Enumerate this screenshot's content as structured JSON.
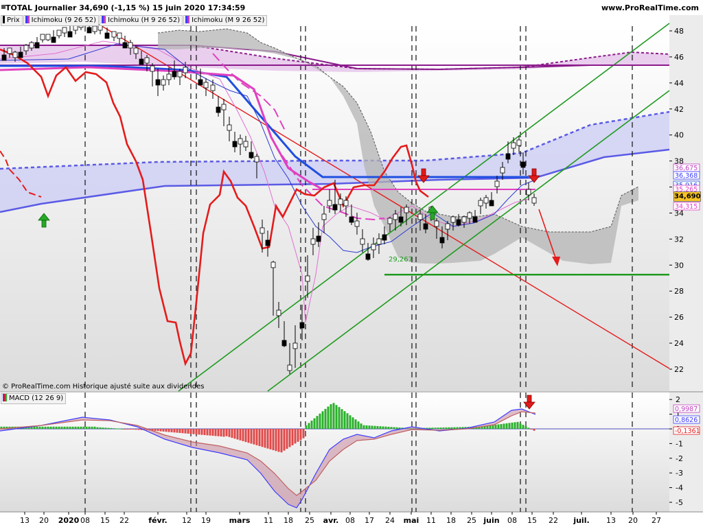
{
  "header": {
    "title": "TOTAL Journalier 34,690 (-1,15 %) 15 juin 2020 17:34:59",
    "site": "www.ProRealTime.com"
  },
  "legend": {
    "items": [
      {
        "label": "Prix",
        "color": "#000000"
      },
      {
        "label": "Ichimoku (9 26 52)",
        "color": "#3c3cff"
      },
      {
        "label": "Ichimoku (H 9 26 52)",
        "color": "#c040c0"
      },
      {
        "label": "Ichimoku (M 9 26 52)",
        "color": "#9090ff"
      }
    ]
  },
  "watermark": "© ProRealTime.com Historique ajusté suite aux dividendes",
  "macd_legend": "MACD (12 26 9)",
  "price_tag": "34,690",
  "annotations": {
    "support_label": "29,267"
  },
  "colors": {
    "price_axis_bg": "#ececec",
    "cloud_grey": "#b4b4b4",
    "cloud_purple": "#e3bfe8",
    "cloud_blue": "#c9c9f5",
    "kijun_blue": "#1f4fe0",
    "red_line": "#e51b1b",
    "green_line": "#1e9a1e",
    "arrow_red": "#e01b1b",
    "arrow_green": "#28a828"
  },
  "chart_data": [
    {
      "type": "candlestick",
      "title": "TOTAL Journalier",
      "y_axis_ticks": [
        48,
        46,
        44,
        42,
        40,
        38,
        36,
        34,
        32,
        30,
        28,
        26,
        24,
        22
      ],
      "y_range": [
        20,
        49
      ],
      "x_tick_labels": [
        "13",
        "20",
        "2020",
        "08",
        "15",
        "22",
        "févr.",
        "12",
        "19",
        "mars",
        "11",
        "18",
        "25",
        "avr.",
        "08",
        "17",
        "24",
        "mai",
        "11",
        "18",
        "25",
        "juin",
        "08",
        "15",
        "22",
        "juil.",
        "13",
        "20",
        "27"
      ],
      "price_labels": [
        {
          "label": "36,675",
          "value": 36.675,
          "color": "#c040c0"
        },
        {
          "label": "36,368",
          "value": 36.368,
          "color": "#3c3cff"
        },
        {
          "label": "35,916",
          "value": 35.916,
          "color": "#1f4fe0"
        },
        {
          "label": "35,265",
          "value": 35.265,
          "color": "#e040c0"
        },
        {
          "label": "34,690",
          "value": 34.69,
          "color": "#000000"
        },
        {
          "label": "34,315",
          "value": 34.315,
          "color": "#e040c0"
        }
      ],
      "last_close": 34.69,
      "support_level": 29.267
    },
    {
      "type": "bar",
      "title": "MACD (12 26 9)",
      "y_axis_ticks": [
        2,
        1,
        0,
        -1,
        -2,
        -3,
        -4,
        -5
      ],
      "y_range": [
        -5.5,
        2.5
      ],
      "value_labels": [
        {
          "label": "0,9987",
          "value": 0.9987,
          "color": "#c040c0"
        },
        {
          "label": "0,8626",
          "value": 0.8626,
          "color": "#3c3cff"
        },
        {
          "label": "-0,1361",
          "value": -0.1361,
          "color": "#e51b1b"
        }
      ]
    }
  ]
}
